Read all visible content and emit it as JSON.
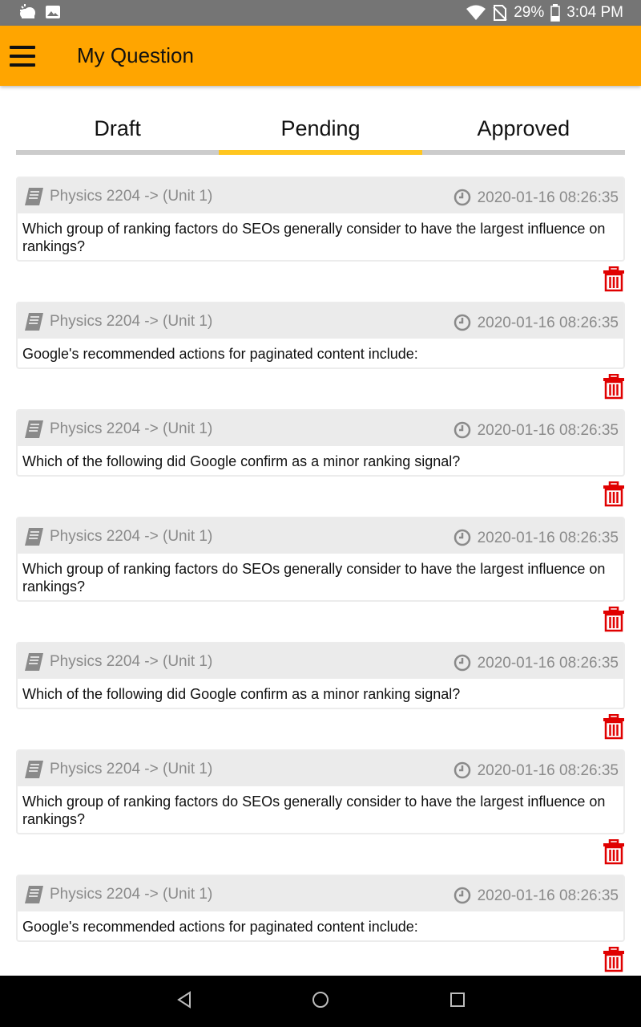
{
  "status_bar": {
    "battery": "29%",
    "time": "3:04 PM",
    "icons": [
      "weather-icon",
      "image-icon",
      "wifi-icon",
      "no-sim-icon",
      "battery-icon"
    ]
  },
  "app_bar": {
    "title": "My Question",
    "menu_icon": "hamburger-menu-icon",
    "color": "#FFA500"
  },
  "tabs": [
    {
      "label": "Draft",
      "active": false
    },
    {
      "label": "Pending",
      "active": true
    },
    {
      "label": "Approved",
      "active": false
    }
  ],
  "accent_color": "#FFC61F",
  "delete_color": "#E00000",
  "questions": [
    {
      "subject": "Physics 2204 -> (Unit 1)",
      "date": "2020-01-16 08:26:35",
      "text": "Which group of ranking factors do SEOs generally consider to have the largest influence on rankings?"
    },
    {
      "subject": "Physics 2204 -> (Unit 1)",
      "date": "2020-01-16 08:26:35",
      "text": "Google's recommended actions for paginated content include:"
    },
    {
      "subject": "Physics 2204 -> (Unit 1)",
      "date": "2020-01-16 08:26:35",
      "text": "Which of the following did Google confirm as a minor ranking signal?"
    },
    {
      "subject": "Physics 2204 -> (Unit 1)",
      "date": "2020-01-16 08:26:35",
      "text": "Which group of ranking factors do SEOs generally consider to have the largest influence on rankings?"
    },
    {
      "subject": "Physics 2204 -> (Unit 1)",
      "date": "2020-01-16 08:26:35",
      "text": "Which of the following did Google confirm as a minor ranking signal?"
    },
    {
      "subject": "Physics 2204 -> (Unit 1)",
      "date": "2020-01-16 08:26:35",
      "text": "Which group of ranking factors do SEOs generally consider to have the largest influence on rankings?"
    },
    {
      "subject": "Physics 2204 -> (Unit 1)",
      "date": "2020-01-16 08:26:35",
      "text": "Google's recommended actions for paginated content include:"
    }
  ],
  "nav_bar": {
    "icons": [
      "back-icon",
      "home-icon",
      "recents-icon"
    ]
  }
}
